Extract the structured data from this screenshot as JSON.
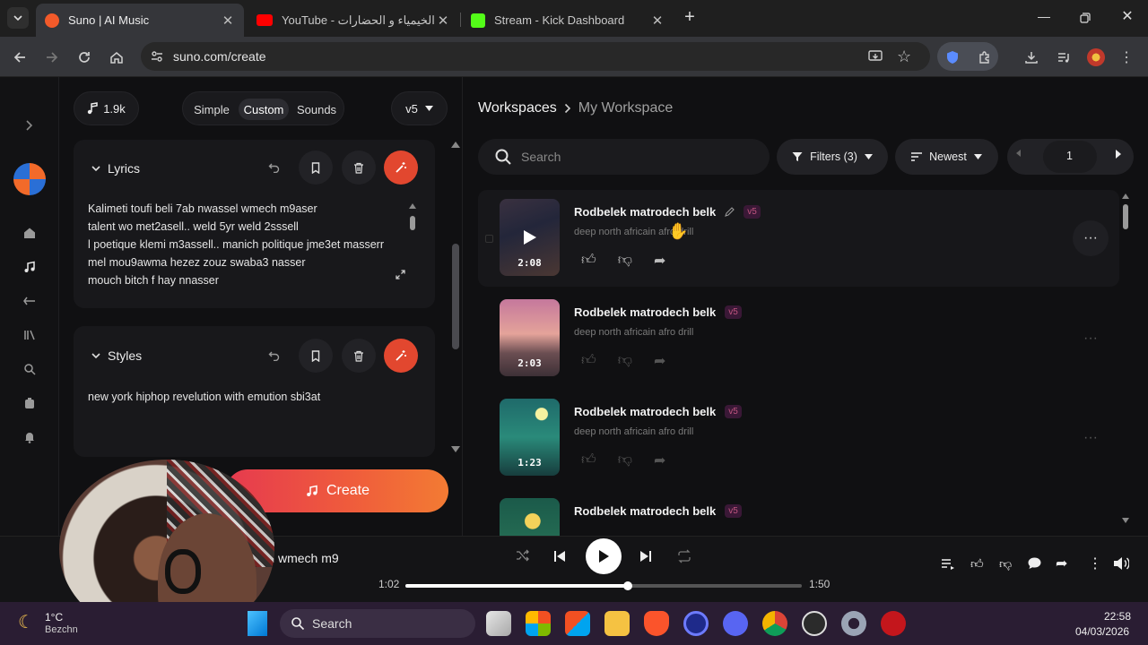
{
  "browser": {
    "tabs": [
      {
        "title": "Suno | AI Music",
        "active": true,
        "favicon_color": "#f25a2a"
      },
      {
        "title": "YouTube - الخيمياء و الحضارات !",
        "active": false,
        "favicon_color": "#ff0000"
      },
      {
        "title": "Stream - Kick Dashboard",
        "active": false,
        "favicon_color": "#53fc18"
      }
    ],
    "new_tab": "+",
    "url": "suno.com/create"
  },
  "left": {
    "credits": "1.9k",
    "modes": [
      "Simple",
      "Custom",
      "Sounds"
    ],
    "active_mode": "Custom",
    "version": "v5",
    "lyrics": {
      "title": "Lyrics",
      "lines": [
        "Kalimeti toufi beli 7ab nwassel wmech m9aser",
        "talent wo met2asell.. weld 5yr weld 2sssell",
        "l poetique klemi m3assell.. manich politique jme3et masserr",
        "mel mou9awma hezez zouz swaba3 nasser",
        "mouch bitch f hay nnasser"
      ]
    },
    "styles": {
      "title": "Styles",
      "text": "new york hiphop  revelution  with emution sbi3at"
    },
    "create_label": "Create"
  },
  "workspace": {
    "root": "Workspaces",
    "current": "My Workspace",
    "search_placeholder": "Search",
    "filters_label": "Filters (3)",
    "sort_label": "Newest",
    "page": "1"
  },
  "songs": [
    {
      "title": "Rodbelek matrodech belk",
      "genre": "deep north africain afro drill",
      "duration": "2:08",
      "badge": "v5"
    },
    {
      "title": "Rodbelek matrodech belk",
      "genre": "deep north africain afro drill",
      "duration": "2:03",
      "badge": "v5"
    },
    {
      "title": "Rodbelek matrodech belk",
      "genre": "deep north africain afro drill",
      "duration": "1:23",
      "badge": "v5"
    },
    {
      "title": "Rodbelek matrodech belk",
      "genre": "",
      "duration": "",
      "badge": "v5"
    }
  ],
  "player": {
    "now_playing": "l wmech m9",
    "elapsed": "1:02",
    "total": "1:50",
    "progress": 0.56
  },
  "taskbar": {
    "weather_temp": "1°C",
    "weather_loc": "Bezchn",
    "search_label": "Search",
    "time": "22:58",
    "date": "04/03/2026"
  },
  "colors": {
    "accent": "#e2472f",
    "badge": "#c0557f"
  }
}
